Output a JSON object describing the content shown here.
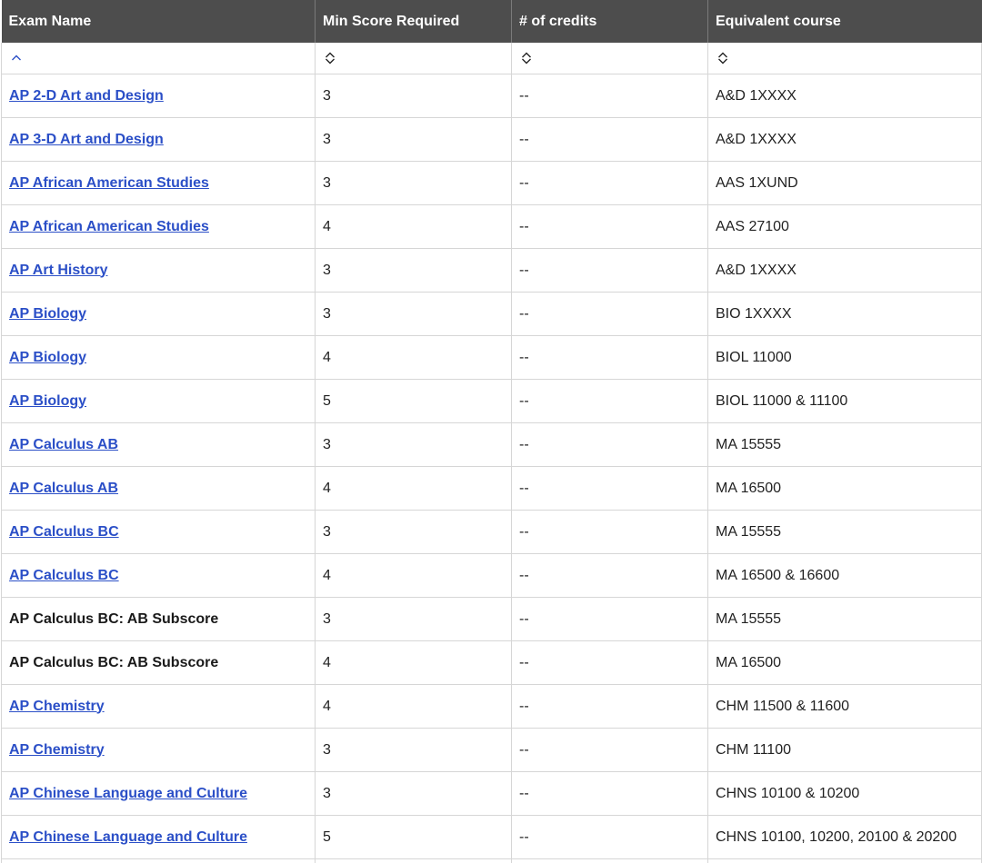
{
  "table": {
    "headers": [
      "Exam Name",
      "Min Score Required",
      "# of credits",
      "Equivalent course"
    ],
    "sort_icons": [
      "chevron-up-icon",
      "sort-updown-icon",
      "sort-updown-icon",
      "sort-updown-icon"
    ],
    "accent_link_color": "#2b4fc7",
    "header_bg": "#4d4d4d",
    "rows": [
      {
        "exam": "AP 2-D Art and Design",
        "link": true,
        "score": "3",
        "credits": "--",
        "course": "A&D 1XXXX"
      },
      {
        "exam": "AP 3-D Art and Design",
        "link": true,
        "score": "3",
        "credits": "--",
        "course": "A&D 1XXXX"
      },
      {
        "exam": "AP African American Studies",
        "link": true,
        "score": "3",
        "credits": "--",
        "course": "AAS 1XUND"
      },
      {
        "exam": "AP African American Studies",
        "link": true,
        "score": "4",
        "credits": "--",
        "course": "AAS 27100"
      },
      {
        "exam": "AP Art History",
        "link": true,
        "score": "3",
        "credits": "--",
        "course": "A&D 1XXXX"
      },
      {
        "exam": "AP Biology",
        "link": true,
        "score": "3",
        "credits": "--",
        "course": "BIO 1XXXX"
      },
      {
        "exam": "AP Biology",
        "link": true,
        "score": "4",
        "credits": "--",
        "course": "BIOL 11000"
      },
      {
        "exam": "AP Biology",
        "link": true,
        "score": "5",
        "credits": "--",
        "course": "BIOL 11000 & 11100"
      },
      {
        "exam": "AP Calculus AB",
        "link": true,
        "score": "3",
        "credits": "--",
        "course": "MA 15555"
      },
      {
        "exam": "AP Calculus AB",
        "link": true,
        "score": "4",
        "credits": "--",
        "course": "MA 16500"
      },
      {
        "exam": "AP Calculus BC",
        "link": true,
        "score": "3",
        "credits": "--",
        "course": "MA 15555"
      },
      {
        "exam": "AP Calculus BC",
        "link": true,
        "score": "4",
        "credits": "--",
        "course": "MA 16500 & 16600"
      },
      {
        "exam": "AP Calculus BC: AB Subscore",
        "link": false,
        "score": "3",
        "credits": "--",
        "course": "MA 15555"
      },
      {
        "exam": "AP Calculus BC: AB Subscore",
        "link": false,
        "score": "4",
        "credits": "--",
        "course": "MA 16500"
      },
      {
        "exam": "AP Chemistry",
        "link": true,
        "score": "4",
        "credits": "--",
        "course": "CHM 11500 & 11600"
      },
      {
        "exam": "AP Chemistry",
        "link": true,
        "score": "3",
        "credits": "--",
        "course": "CHM 11100"
      },
      {
        "exam": "AP Chinese Language and Culture",
        "link": true,
        "score": "3",
        "credits": "--",
        "course": "CHNS 10100 & 10200"
      },
      {
        "exam": "AP Chinese Language and Culture",
        "link": true,
        "score": "5",
        "credits": "--",
        "course": "CHNS 10100, 10200, 20100 & 20200"
      },
      {
        "exam": "",
        "link": false,
        "score": "",
        "credits": "",
        "course": ""
      }
    ]
  }
}
